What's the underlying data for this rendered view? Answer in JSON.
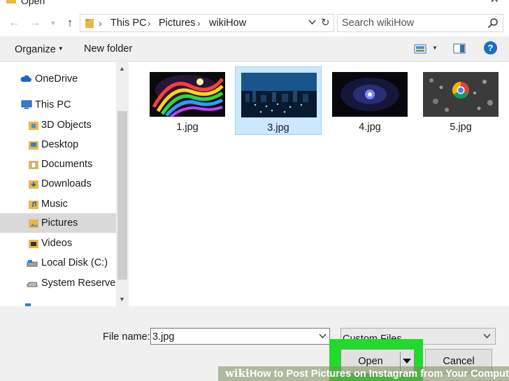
{
  "window": {
    "title": "Open"
  },
  "nav": {
    "path": [
      "This PC",
      "Pictures",
      "wikiHow"
    ],
    "search_placeholder": "Search wikiHow"
  },
  "toolbar": {
    "organize_label": "Organize",
    "new_folder_label": "New folder",
    "help_glyph": "?"
  },
  "sidebar": {
    "items": [
      {
        "label": "OneDrive",
        "icon": "cloud-icon",
        "active": false
      },
      {
        "label": "This PC",
        "icon": "computer-icon",
        "active": false
      },
      {
        "label": "3D Objects",
        "icon": "3d-objects-folder-icon",
        "active": false
      },
      {
        "label": "Desktop",
        "icon": "desktop-folder-icon",
        "active": false
      },
      {
        "label": "Documents",
        "icon": "documents-folder-icon",
        "active": false
      },
      {
        "label": "Downloads",
        "icon": "downloads-folder-icon",
        "active": false
      },
      {
        "label": "Music",
        "icon": "music-folder-icon",
        "active": false
      },
      {
        "label": "Pictures",
        "icon": "pictures-folder-icon",
        "active": true
      },
      {
        "label": "Videos",
        "icon": "videos-folder-icon",
        "active": false
      },
      {
        "label": "Local Disk (C:)",
        "icon": "disk-drive-icon",
        "active": false
      },
      {
        "label": "System Reserved",
        "icon": "disk-drive-icon",
        "active": false
      }
    ]
  },
  "files": [
    {
      "name": "1.jpg",
      "selected": false
    },
    {
      "name": "3.jpg",
      "selected": true
    },
    {
      "name": "4.jpg",
      "selected": false
    },
    {
      "name": "5.jpg",
      "selected": false
    }
  ],
  "footer": {
    "file_name_label": "File name:",
    "file_name_value": "3.jpg",
    "file_type_value": "Custom Files",
    "open_label": "Open",
    "cancel_label": "Cancel"
  },
  "watermark": {
    "logo": "wiki",
    "text": "How to Post Pictures on Instagram from Your Computer"
  },
  "colors": {
    "selection": "#cce8ff",
    "highlight": "#1fdc2a",
    "help_button": "#1c6ec9"
  }
}
